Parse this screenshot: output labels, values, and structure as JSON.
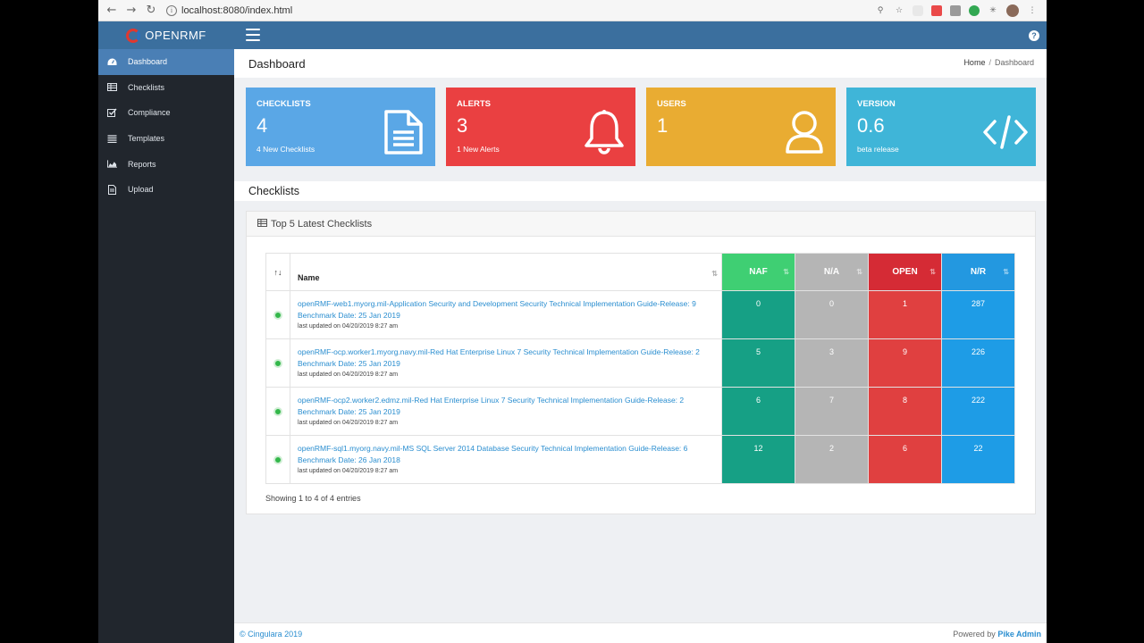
{
  "browser": {
    "url": "localhost:8080/index.html"
  },
  "app": {
    "brand": "OPENRMF"
  },
  "sidebar": {
    "items": [
      {
        "label": "Dashboard",
        "icon": "dashboard-icon",
        "active": true
      },
      {
        "label": "Checklists",
        "icon": "table-icon"
      },
      {
        "label": "Compliance",
        "icon": "check-square-icon"
      },
      {
        "label": "Templates",
        "icon": "list-icon"
      },
      {
        "label": "Reports",
        "icon": "area-chart-icon"
      },
      {
        "label": "Upload",
        "icon": "file-icon"
      }
    ]
  },
  "header": {
    "title": "Dashboard",
    "breadcrumb": {
      "home": "Home",
      "sep": "/",
      "current": "Dashboard"
    }
  },
  "cards": [
    {
      "title": "CHECKLISTS",
      "value": "4",
      "sub": "4 New Checklists",
      "color": "#5aa7e6",
      "icon": "document-icon"
    },
    {
      "title": "ALERTS",
      "value": "3",
      "sub": "1 New Alerts",
      "color": "#ea4041",
      "icon": "bell-icon"
    },
    {
      "title": "USERS",
      "value": "1",
      "sub": "",
      "color": "#e9ac32",
      "icon": "user-icon"
    },
    {
      "title": "VERSION",
      "value": "0.6",
      "sub": "beta release",
      "color": "#3fb5d8",
      "icon": "code-icon"
    }
  ],
  "section": {
    "title": "Checklists"
  },
  "panel": {
    "title": "Top 5 Latest Checklists",
    "columns": {
      "sort": "↑↓",
      "name": "Name",
      "naf": "NAF",
      "na": "N/A",
      "open": "OPEN",
      "nr": "N/R"
    },
    "rows": [
      {
        "name": "openRMF-web1.myorg.mil-Application Security and Development Security Technical Implementation Guide-Release: 9 Benchmark Date: 25 Jan 2019",
        "updated": "last updated on 04/20/2019 8:27 am",
        "naf": "0",
        "na": "0",
        "open": "1",
        "nr": "287"
      },
      {
        "name": "openRMF-ocp.worker1.myorg.navy.mil-Red Hat Enterprise Linux 7 Security Technical Implementation Guide-Release: 2 Benchmark Date: 25 Jan 2019",
        "updated": "last updated on 04/20/2019 8:27 am",
        "naf": "5",
        "na": "3",
        "open": "9",
        "nr": "226"
      },
      {
        "name": "openRMF-ocp2.worker2.edmz.mil-Red Hat Enterprise Linux 7 Security Technical Implementation Guide-Release: 2 Benchmark Date: 25 Jan 2019",
        "updated": "last updated on 04/20/2019 8:27 am",
        "naf": "6",
        "na": "7",
        "open": "8",
        "nr": "222"
      },
      {
        "name": "openRMF-sql1.myorg.navy.mil-MS SQL Server 2014 Database Security Technical Implementation Guide-Release: 6 Benchmark Date: 26 Jan 2018",
        "updated": "last updated on 04/20/2019 8:27 am",
        "naf": "12",
        "na": "2",
        "open": "6",
        "nr": "22"
      }
    ],
    "info": "Showing 1 to 4 of 4 entries"
  },
  "footer": {
    "left": "© Cingulara 2019",
    "right_prefix": "Powered by",
    "right_link": "Pike Admin"
  }
}
